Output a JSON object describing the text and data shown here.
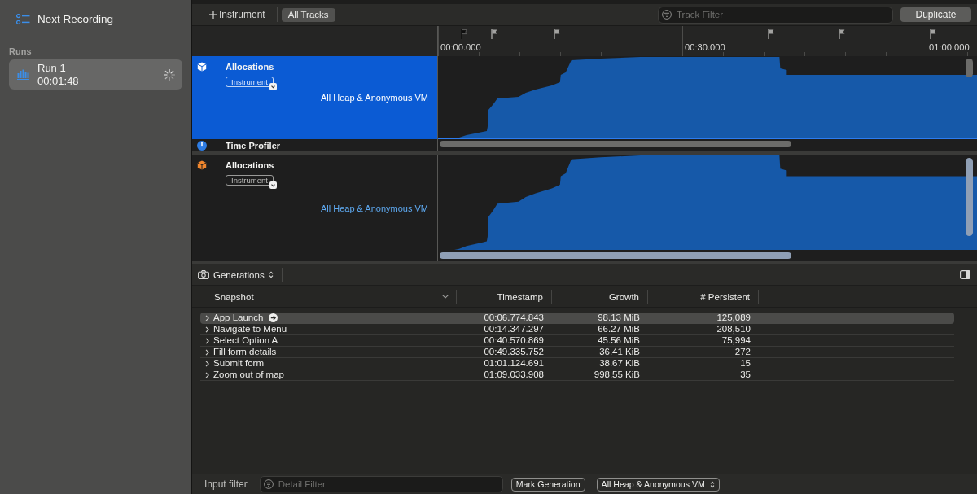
{
  "sidebar": {
    "title": "Next Recording",
    "section": "Runs",
    "runs": [
      {
        "name": "Run 1",
        "duration": "00:01:48",
        "selected": true,
        "recording": true
      }
    ]
  },
  "toolbar": {
    "add_button": "Instrument",
    "scope_buttons": [
      {
        "label": "All Tracks",
        "selected": true
      }
    ],
    "filter": {
      "placeholder": "Track Filter"
    },
    "duplicate_button": "Duplicate"
  },
  "ruler": {
    "labels": [
      "00:00.000",
      "00:30.000",
      "01:00.000"
    ]
  },
  "panes": [
    {
      "tracks": [
        {
          "kind": "allocations",
          "name": "Allocations",
          "tag": "Instrument",
          "detail": "All Heap & Anonymous VM",
          "selected": true
        },
        {
          "kind": "profiler",
          "name": "Time Profiler",
          "selected": false,
          "color": "#2d7ce4"
        }
      ]
    },
    {
      "tracks": [
        {
          "kind": "allocations",
          "name": "Allocations",
          "tag": "Instrument",
          "detail": "All Heap & Anonymous VM",
          "selected": false,
          "color": "#f0862d"
        }
      ]
    }
  ],
  "detail": {
    "view_menu": "Generations",
    "columns": [
      "Snapshot",
      "Timestamp",
      "Growth",
      "# Persistent"
    ],
    "rows": [
      {
        "snapshot": "App Launch",
        "timestamp": "00:06.774.843",
        "growth": "98.13 MiB",
        "persistent": "125,089",
        "selected": true,
        "expanded": false
      },
      {
        "snapshot": "Navigate to Menu",
        "timestamp": "00:14.347.297",
        "growth": "66.27 MiB",
        "persistent": "208,510",
        "selected": false,
        "expanded": false
      },
      {
        "snapshot": "Select Option A",
        "timestamp": "00:40.570.869",
        "growth": "45.56 MiB",
        "persistent": "75,994",
        "selected": false,
        "expanded": false
      },
      {
        "snapshot": "Fill form details",
        "timestamp": "00:49.335.752",
        "growth": "36.41 KiB",
        "persistent": "272",
        "selected": false,
        "expanded": false
      },
      {
        "snapshot": "Submit form",
        "timestamp": "01:01.124.691",
        "growth": "38.67 KiB",
        "persistent": "15",
        "selected": false,
        "expanded": false
      },
      {
        "snapshot": "Zoom out of map",
        "timestamp": "01:09.033.908",
        "growth": "998.55 KiB",
        "persistent": "35",
        "selected": false,
        "expanded": false
      }
    ]
  },
  "bottom_bar": {
    "label": "Input filter",
    "filter": {
      "placeholder": "Detail Filter"
    },
    "mark_button": "Mark Generation",
    "scope_popup": "All Heap & Anonymous VM"
  }
}
